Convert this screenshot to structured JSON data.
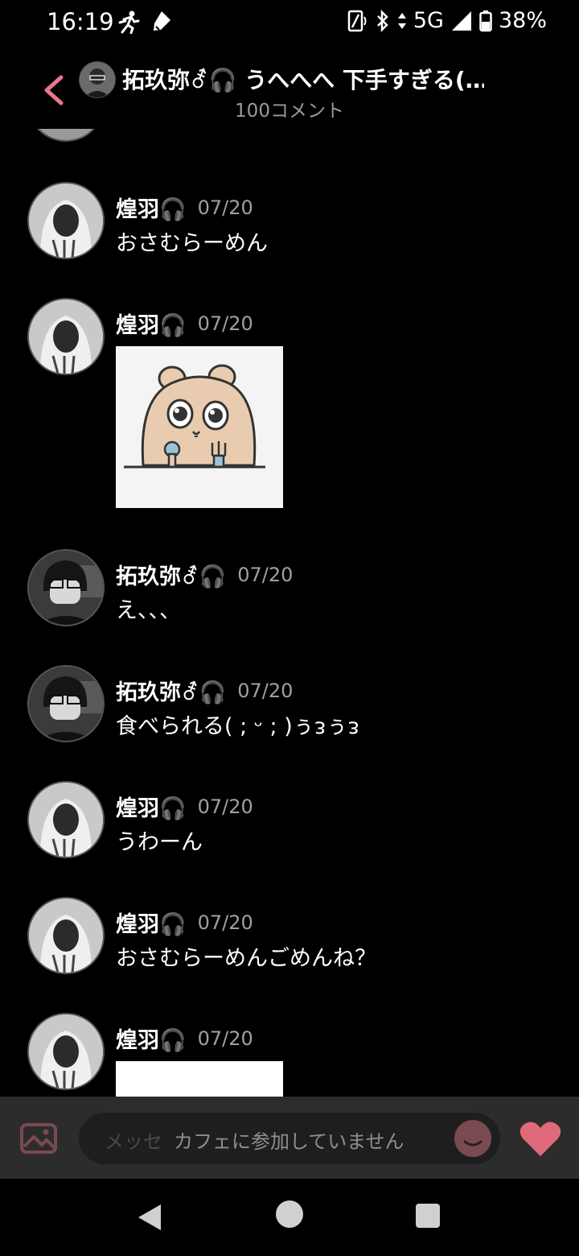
{
  "status_bar": {
    "time": "16:19",
    "network": "5G",
    "battery": "38%",
    "icons": [
      "running-person-icon",
      "pencil-tag-icon",
      "nfc-icon",
      "bluetooth-icon",
      "data-arrows-icon",
      "signal-icon",
      "battery-icon"
    ]
  },
  "header": {
    "title": "拓玖弥⚦🎧 うへへへ 下手すぎる(…",
    "subtitle": "100コメント",
    "back_icon": "chevron-left-icon"
  },
  "comments": [
    {
      "name": "煌羽🎧",
      "date": "07/20",
      "text": "おさむらーめん",
      "avatar": "light"
    },
    {
      "name": "煌羽🎧",
      "date": "07/20",
      "text": "",
      "avatar": "light",
      "sticker": "hamster-sticker"
    },
    {
      "name": "拓玖弥⚦🎧",
      "date": "07/20",
      "text": "え、、、",
      "avatar": "dark"
    },
    {
      "name": "拓玖弥⚦🎧",
      "date": "07/20",
      "text": "食べられる( ; ᵕ ; )ぅᴈぅᴈ",
      "avatar": "dark"
    },
    {
      "name": "煌羽🎧",
      "date": "07/20",
      "text": "うわーん",
      "avatar": "light"
    },
    {
      "name": "煌羽🎧",
      "date": "07/20",
      "text": "おさむらーめんごめんね？",
      "avatar": "light"
    },
    {
      "name": "煌羽🎧",
      "date": "07/20",
      "text": "",
      "avatar": "light",
      "sticker": "partial-sticker"
    }
  ],
  "input_bar": {
    "placeholder": "メッセ",
    "notice": "カフェに参加していません"
  },
  "colors": {
    "accent_pink": "#e8788c",
    "heart": "#e06a7c",
    "muted_pink": "#7a4a52"
  }
}
